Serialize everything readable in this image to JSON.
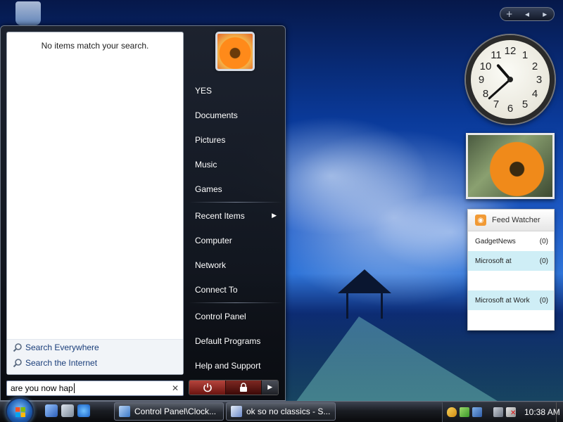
{
  "start_menu": {
    "no_results": "No items match your search.",
    "search_everywhere": "Search Everywhere",
    "search_internet": "Search the Internet",
    "search_value": "are you now hap",
    "clear_icon": "close-icon",
    "right_links": [
      {
        "label": "YES"
      },
      {
        "label": "Documents"
      },
      {
        "label": "Pictures"
      },
      {
        "label": "Music"
      },
      {
        "label": "Games"
      },
      {
        "label": "Recent Items"
      },
      {
        "label": "Computer"
      },
      {
        "label": "Network"
      },
      {
        "label": "Connect To"
      },
      {
        "label": "Control Panel"
      },
      {
        "label": "Default Programs"
      },
      {
        "label": "Help and Support"
      }
    ]
  },
  "gadgets": {
    "feed": {
      "title": "Feed Watcher",
      "items": [
        {
          "name": "GadgetNews",
          "count": "(0)"
        },
        {
          "name": "Microsoft at",
          "count": "(0)"
        },
        {
          "name": "",
          "count": ""
        },
        {
          "name": "Microsoft at Work",
          "count": "(0)"
        }
      ]
    },
    "clock": {
      "hour": 10,
      "minute": 38
    }
  },
  "taskbar": {
    "buttons": [
      {
        "label": "Control Panel\\Clock..."
      },
      {
        "label": "ok so no classics - S..."
      }
    ],
    "time": "10:38 AM"
  },
  "colors": {
    "accent": "#1e5cb0",
    "feed_highlight": "#cfeef6",
    "power_button": "#b5443c"
  }
}
